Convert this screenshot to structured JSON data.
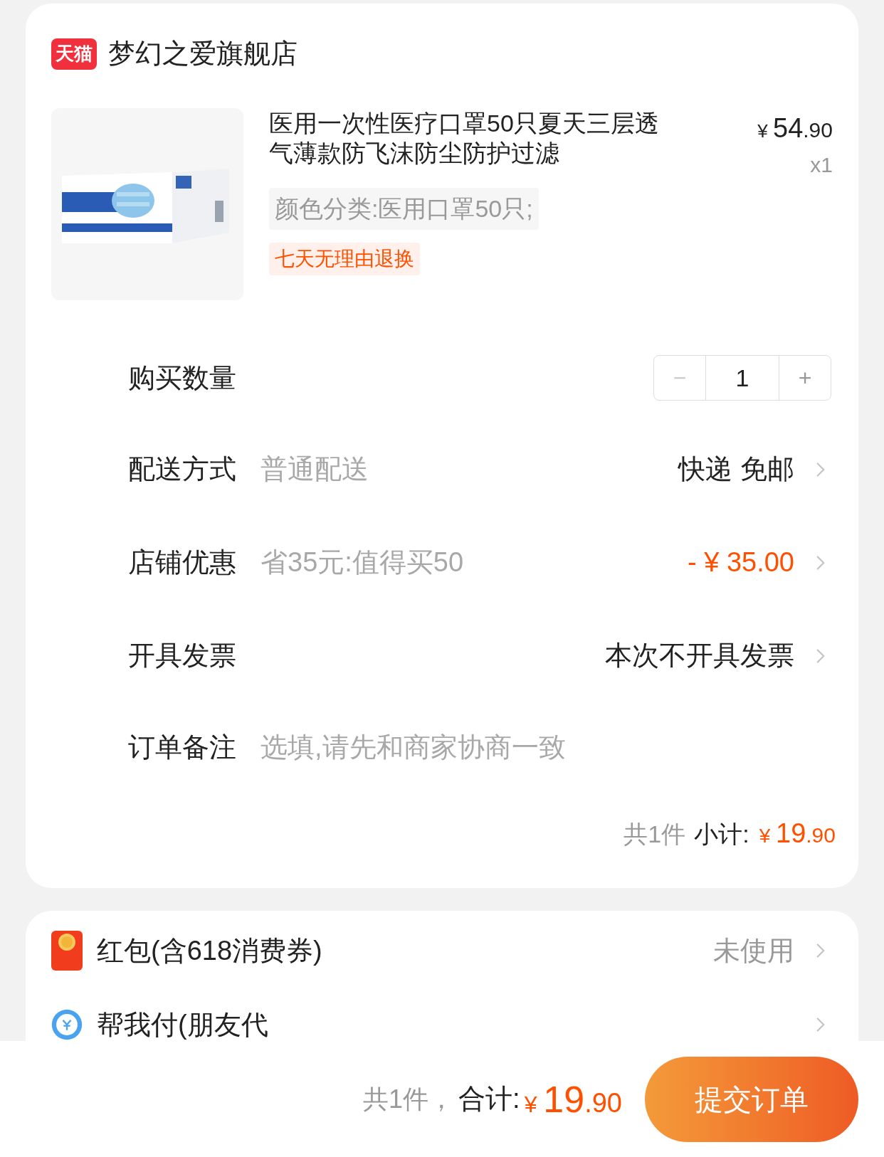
{
  "store": {
    "badge": "天猫",
    "name": "梦幻之爱旗舰店"
  },
  "product": {
    "title": "医用一次性医疗口罩50只夏天三层透气薄款防飞沫防尘防护过滤",
    "currency": "¥",
    "price_int": "54",
    "price_dec": ".90",
    "quantity": "x1",
    "variant": "颜色分类:医用口罩50只;",
    "tag": "七天无理由退换"
  },
  "rows": [
    {
      "kind": "stepper",
      "label": "购买数量",
      "minus": "−",
      "minus_disabled": true,
      "value": "1",
      "plus": "+"
    },
    {
      "kind": "select",
      "label": "配送方式",
      "hint": "普通配送",
      "value": "快递 免邮",
      "accent": false
    },
    {
      "kind": "select",
      "label": "店铺优惠",
      "hint": "省35元:值得买50",
      "value": "- ¥ 35.00",
      "accent": true
    },
    {
      "kind": "select",
      "label": "开具发票",
      "value": "本次不开具发票",
      "accent": false
    },
    {
      "kind": "note",
      "label": "订单备注",
      "placeholder": "选填,请先和商家协商一致"
    }
  ],
  "subtotal": {
    "count": "共1件",
    "label": "小计:",
    "currency": "¥",
    "int": "19",
    "dec": ".90"
  },
  "extras": [
    {
      "kind": "red-packet",
      "label": "红包(含618消费券)",
      "value": "未使用"
    },
    {
      "kind": "friend-pay",
      "label": "帮我付(朋友代"
    }
  ],
  "footer": {
    "count": "共1件，",
    "label": "合计:",
    "currency": "¥",
    "int": "19",
    "dec": ".90",
    "button": "提交订单"
  }
}
